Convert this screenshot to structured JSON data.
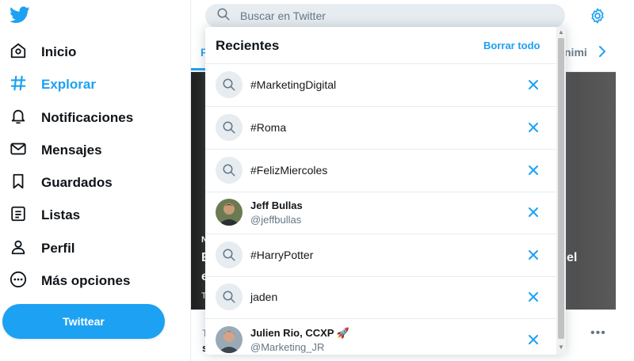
{
  "colors": {
    "accent": "#1da1f2",
    "text": "#0f1419",
    "muted": "#657786",
    "border": "#e6ecf0"
  },
  "sidebar": {
    "logo_icon": "twitter-bird-icon",
    "items": [
      {
        "label": "Inicio",
        "icon": "home-icon"
      },
      {
        "label": "Explorar",
        "icon": "hashtag-icon",
        "active": true
      },
      {
        "label": "Notificaciones",
        "icon": "bell-icon"
      },
      {
        "label": "Mensajes",
        "icon": "envelope-icon"
      },
      {
        "label": "Guardados",
        "icon": "bookmark-icon"
      },
      {
        "label": "Listas",
        "icon": "list-icon"
      },
      {
        "label": "Perfil",
        "icon": "person-icon"
      },
      {
        "label": "Más opciones",
        "icon": "more-circle-icon"
      }
    ],
    "tweet_button": "Twittear"
  },
  "search": {
    "placeholder": "Buscar en Twitter"
  },
  "tabs": {
    "first_fragment": "F",
    "right_fragment": "nimi"
  },
  "hero": {
    "fragments": [
      "N",
      "E",
      "e",
      "T",
      "el"
    ]
  },
  "below_hero": {
    "line1": "T",
    "line2": "s"
  },
  "recent": {
    "title": "Recientes",
    "clear_all": "Borrar todo",
    "items": [
      {
        "type": "search",
        "text": "#MarketingDigital"
      },
      {
        "type": "search",
        "text": "#Roma"
      },
      {
        "type": "search",
        "text": "#FelizMiercoles"
      },
      {
        "type": "user",
        "name": "Jeff Bullas",
        "handle": "@jeffbullas"
      },
      {
        "type": "search",
        "text": "#HarryPotter"
      },
      {
        "type": "search",
        "text": "jaden"
      },
      {
        "type": "user",
        "name": "Julien Rio, CCXP 🚀",
        "handle": "@Marketing_JR"
      }
    ]
  }
}
